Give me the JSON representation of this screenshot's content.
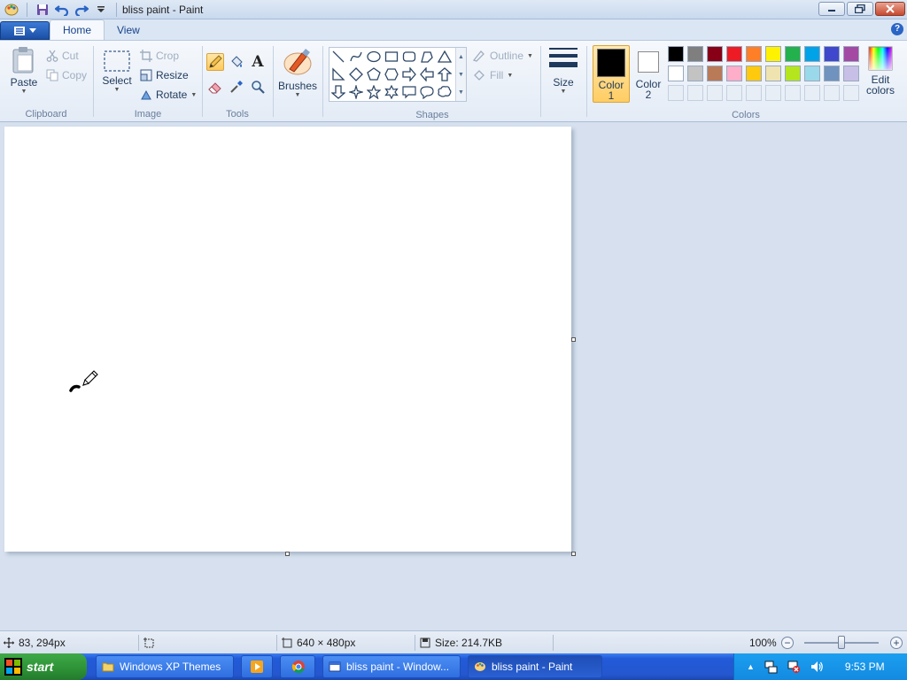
{
  "window": {
    "title": "bliss paint - Paint"
  },
  "tabs": [
    {
      "label": "Home"
    },
    {
      "label": "View"
    }
  ],
  "ribbon": {
    "clipboard": {
      "label": "Clipboard",
      "paste": "Paste",
      "cut": "Cut",
      "copy": "Copy"
    },
    "image": {
      "label": "Image",
      "select": "Select",
      "crop": "Crop",
      "resize": "Resize",
      "rotate": "Rotate"
    },
    "tools": {
      "label": "Tools",
      "active": "pencil"
    },
    "brushes": {
      "label": "Brushes"
    },
    "shapes": {
      "label": "Shapes",
      "outline": "Outline",
      "fill": "Fill"
    },
    "size": {
      "label": "Size"
    },
    "colors": {
      "label": "Colors",
      "color1": "Color",
      "color1_num": "1",
      "color2": "Color",
      "color2_num": "2",
      "edit": "Edit",
      "edit2": "colors",
      "color1_value": "#000000",
      "color2_value": "#ffffff",
      "palette_row1": [
        "#000000",
        "#7f7f7f",
        "#880015",
        "#ed1c24",
        "#ff7f27",
        "#fff200",
        "#22b14c",
        "#00a2e8",
        "#3f48cc",
        "#a349a4"
      ],
      "palette_row2": [
        "#ffffff",
        "#c3c3c3",
        "#b97a57",
        "#ffaec9",
        "#ffc90e",
        "#efe4b0",
        "#b5e61d",
        "#99d9ea",
        "#7092be",
        "#c8bfe7"
      ]
    }
  },
  "status": {
    "cursor_pos": "83, 294px",
    "canvas_size": "640 × 480px",
    "file_size": "Size: 214.7KB",
    "zoom": "100%",
    "zoom_fraction": 0.5
  },
  "taskbar": {
    "start": "start",
    "items": [
      {
        "label": "Windows XP Themes"
      },
      {
        "label": "bliss paint - Window..."
      },
      {
        "label": "bliss paint - Paint"
      }
    ],
    "clock": "9:53 PM"
  }
}
